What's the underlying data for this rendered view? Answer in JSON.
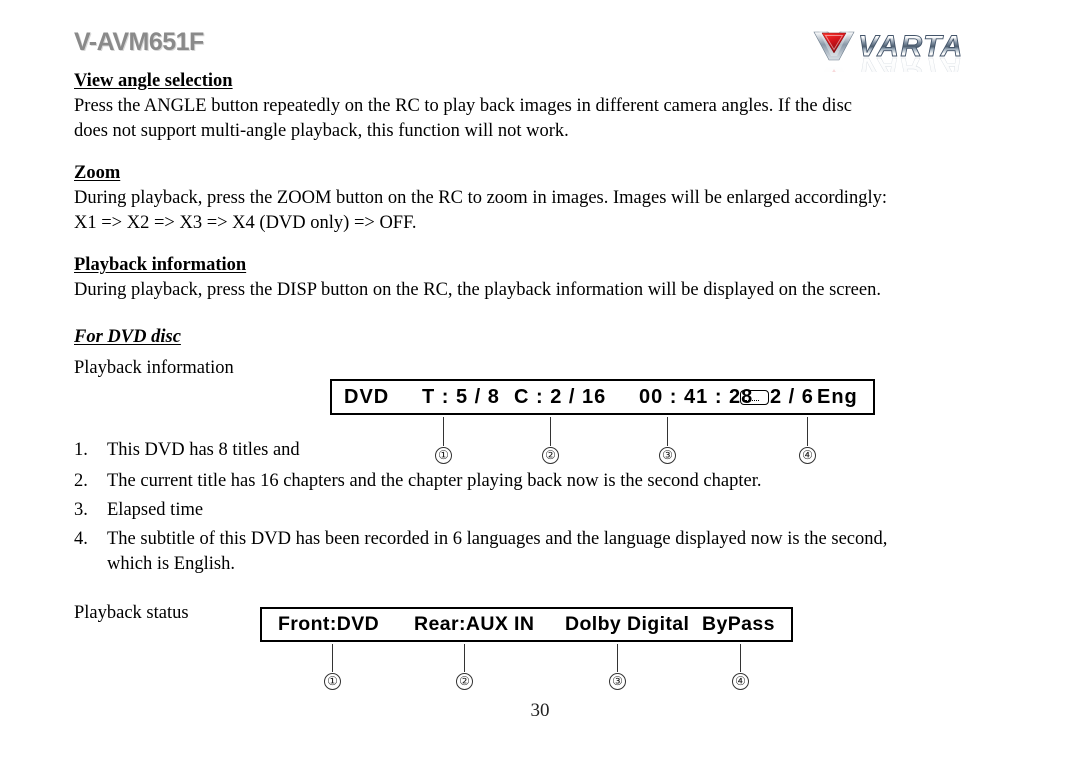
{
  "header": {
    "model_title": "V-AVM651F",
    "logo_text": "VARTA"
  },
  "sections": {
    "view_angle": {
      "heading": "View angle selection",
      "body_line1": "Press the ANGLE button repeatedly on the RC to play back images in different camera angles. If the disc",
      "body_line2": "does not support multi-angle playback, this function will not work."
    },
    "zoom": {
      "heading": "Zoom",
      "body_line1": "During playback, press the ZOOM button on the RC to zoom in images. Images will be enlarged accordingly:",
      "body_line2": "X1 => X2 => X3 => X4 (DVD only) => OFF."
    },
    "playback_information": {
      "heading": "Playback information",
      "body_line1": "During playback, press the DISP button on the RC, the playback information will be displayed on the screen."
    },
    "for_dvd_disc": {
      "heading": "For DVD disc",
      "sub_label_info": "Playback information",
      "sub_label_status": "Playback status"
    }
  },
  "dvd_info_display": {
    "disc_type": "DVD",
    "title_field": "T : 5 / 8",
    "chapter_field": "C : 2 / 16",
    "elapsed_time": "00 : 41 : 28",
    "subtitle_field": "2 / 6",
    "language": "Eng",
    "subtitle_icon": "subtitle-icon"
  },
  "dvd_info_callouts": [
    {
      "num": "①"
    },
    {
      "num": "②"
    },
    {
      "num": "③"
    },
    {
      "num": "④"
    }
  ],
  "explanations": [
    {
      "marker": "1.",
      "text": "This DVD has 8 titles and",
      "text2": ""
    },
    {
      "marker": "2.",
      "text": "The current title has 16 chapters and the chapter playing back now is the second chapter.",
      "text2": ""
    },
    {
      "marker": "3.",
      "text": "Elapsed time",
      "text2": ""
    },
    {
      "marker": "4.",
      "text": "The subtitle of this DVD has been recorded in 6 languages and the language displayed now is the second,",
      "text2": "which is English."
    }
  ],
  "status_display": {
    "front": "Front:DVD",
    "rear": "Rear:AUX IN",
    "audio_format": "Dolby Digital",
    "mode": "ByPass"
  },
  "status_callouts": [
    {
      "num": "①"
    },
    {
      "num": "②"
    },
    {
      "num": "③"
    },
    {
      "num": "④"
    }
  ],
  "footer": {
    "page_number": "30"
  },
  "colors": {
    "title_gray": "#8a8a8a",
    "logo_red": "#d8151c",
    "logo_chrome_light": "#f2f4f6",
    "logo_chrome_dark": "#5f7184",
    "ink": "#000000"
  }
}
